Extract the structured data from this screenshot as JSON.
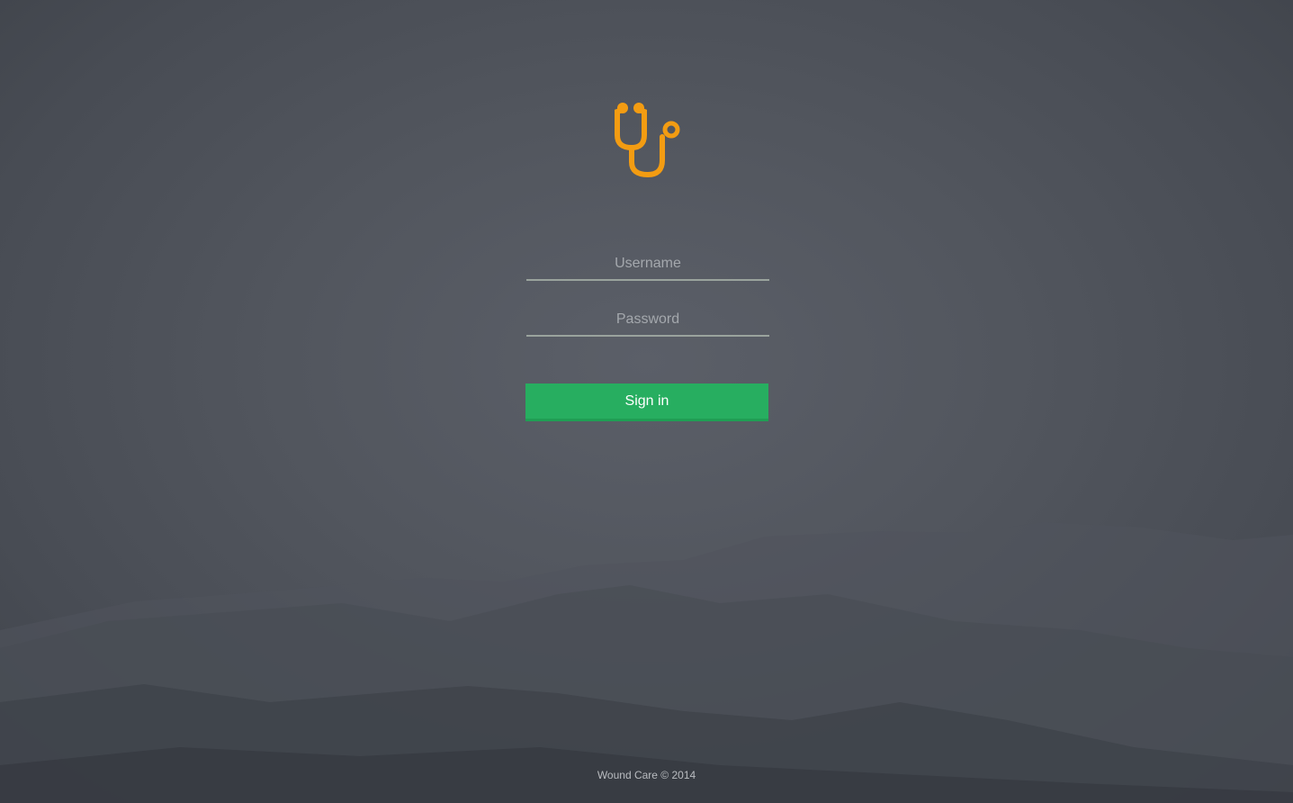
{
  "login": {
    "username_placeholder": "Username",
    "password_placeholder": "Password",
    "signin_label": "Sign in"
  },
  "footer": {
    "text": "Wound Care © 2014"
  },
  "logo": {
    "icon": "stethoscope-icon",
    "color": "#f39c12"
  },
  "colors": {
    "accent_button": "#27ae60",
    "background": "#52565e"
  }
}
